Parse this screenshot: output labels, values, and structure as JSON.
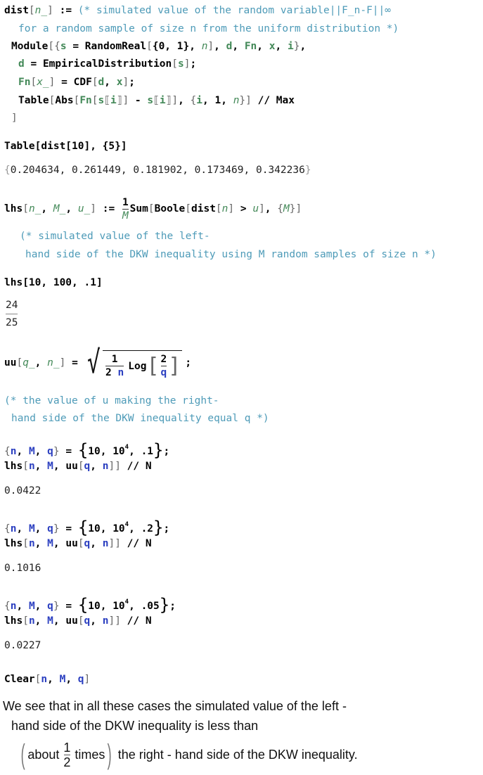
{
  "cell1": {
    "l1_head": "dist",
    "l1_pat": "n_",
    "l1_op": " := ",
    "l1_comment": "(* simulated value of the random variable||F_n-F||∞",
    "l2_comment": "for a random sample of size n from the uniform distribution *)",
    "l3_a": "Module",
    "l3_s": "s",
    "l3_eq": " = ",
    "l3_rr": "RandomReal",
    "l3_args": "{0, 1}, ",
    "l3_n": "n",
    "l3_d": "d",
    "l3_fn": "Fn",
    "l3_x": "x",
    "l3_i": "i",
    "l4_d": "d",
    "l4_ed": "EmpiricalDistribution",
    "l4_s": "s",
    "l5_fn": "Fn",
    "l5_x": "x_",
    "l5_cdf": "CDF",
    "l5_d": "d",
    "l5_xx": "x",
    "l6_table": "Table",
    "l6_abs": "Abs",
    "l6_fn": "Fn",
    "l6_s1": "s",
    "l6_i1": "i",
    "l6_s2": "s",
    "l6_i2": "i",
    "l6_i3": "i",
    "l6_one": "1",
    "l6_n": "n",
    "l6_max": " // Max",
    "l7": "]"
  },
  "cell2": {
    "input": "Table[dist[10], {5}]",
    "output_values": [
      "0.204634",
      "0.261449",
      "0.181902",
      "0.173469",
      "0.342236"
    ]
  },
  "cell3": {
    "head": "lhs",
    "p1": "n_",
    "p2": "M_",
    "p3": "u_",
    "op": " := ",
    "num": "1",
    "den": "M",
    "sum": "Sum",
    "boole": "Boole",
    "dist": "dist",
    "n": "n",
    "gt": " > ",
    "u": "u",
    "M": "M",
    "comment1": "(* simulated value of the left-",
    "comment2": "hand side of the DKW inequality using M random samples of size n *)"
  },
  "cell4": {
    "input": "lhs[10, 100, .1]",
    "out_num": "24",
    "out_den": "25"
  },
  "cell5": {
    "head": "uu",
    "p1": "q_",
    "p2": "n_",
    "eq": " = ",
    "num": "1",
    "den_a": "2 ",
    "den_n": "n",
    "log": "Log",
    "lnum": "2",
    "lden": "q",
    "semi": ";",
    "comment1": "(* the value of u making the right-",
    "comment2": "hand side of the DKW inequality equal q *)"
  },
  "runs": [
    {
      "q": ".1",
      "result": "0.0422"
    },
    {
      "q": ".2",
      "result": "0.1016"
    },
    {
      "q": ".05",
      "result": "0.0227"
    }
  ],
  "run_common": {
    "n": "n",
    "M": "M",
    "q": "q",
    "eq": " = ",
    "ten": "10",
    "base": "10",
    "exp": "4",
    "lhs": "lhs",
    "uu": "uu",
    "postfix": " // N"
  },
  "clear": {
    "head": "Clear",
    "n": "n",
    "M": "M",
    "q": "q"
  },
  "conclusion": {
    "line1": "We see that in all these cases the simulated value of the left -",
    "line2": "hand side of the DKW inequality is less than",
    "about": "about",
    "num": "1",
    "den": "2",
    "times": "times",
    "line3_rest": " the right - hand side of the DKW inequality."
  }
}
